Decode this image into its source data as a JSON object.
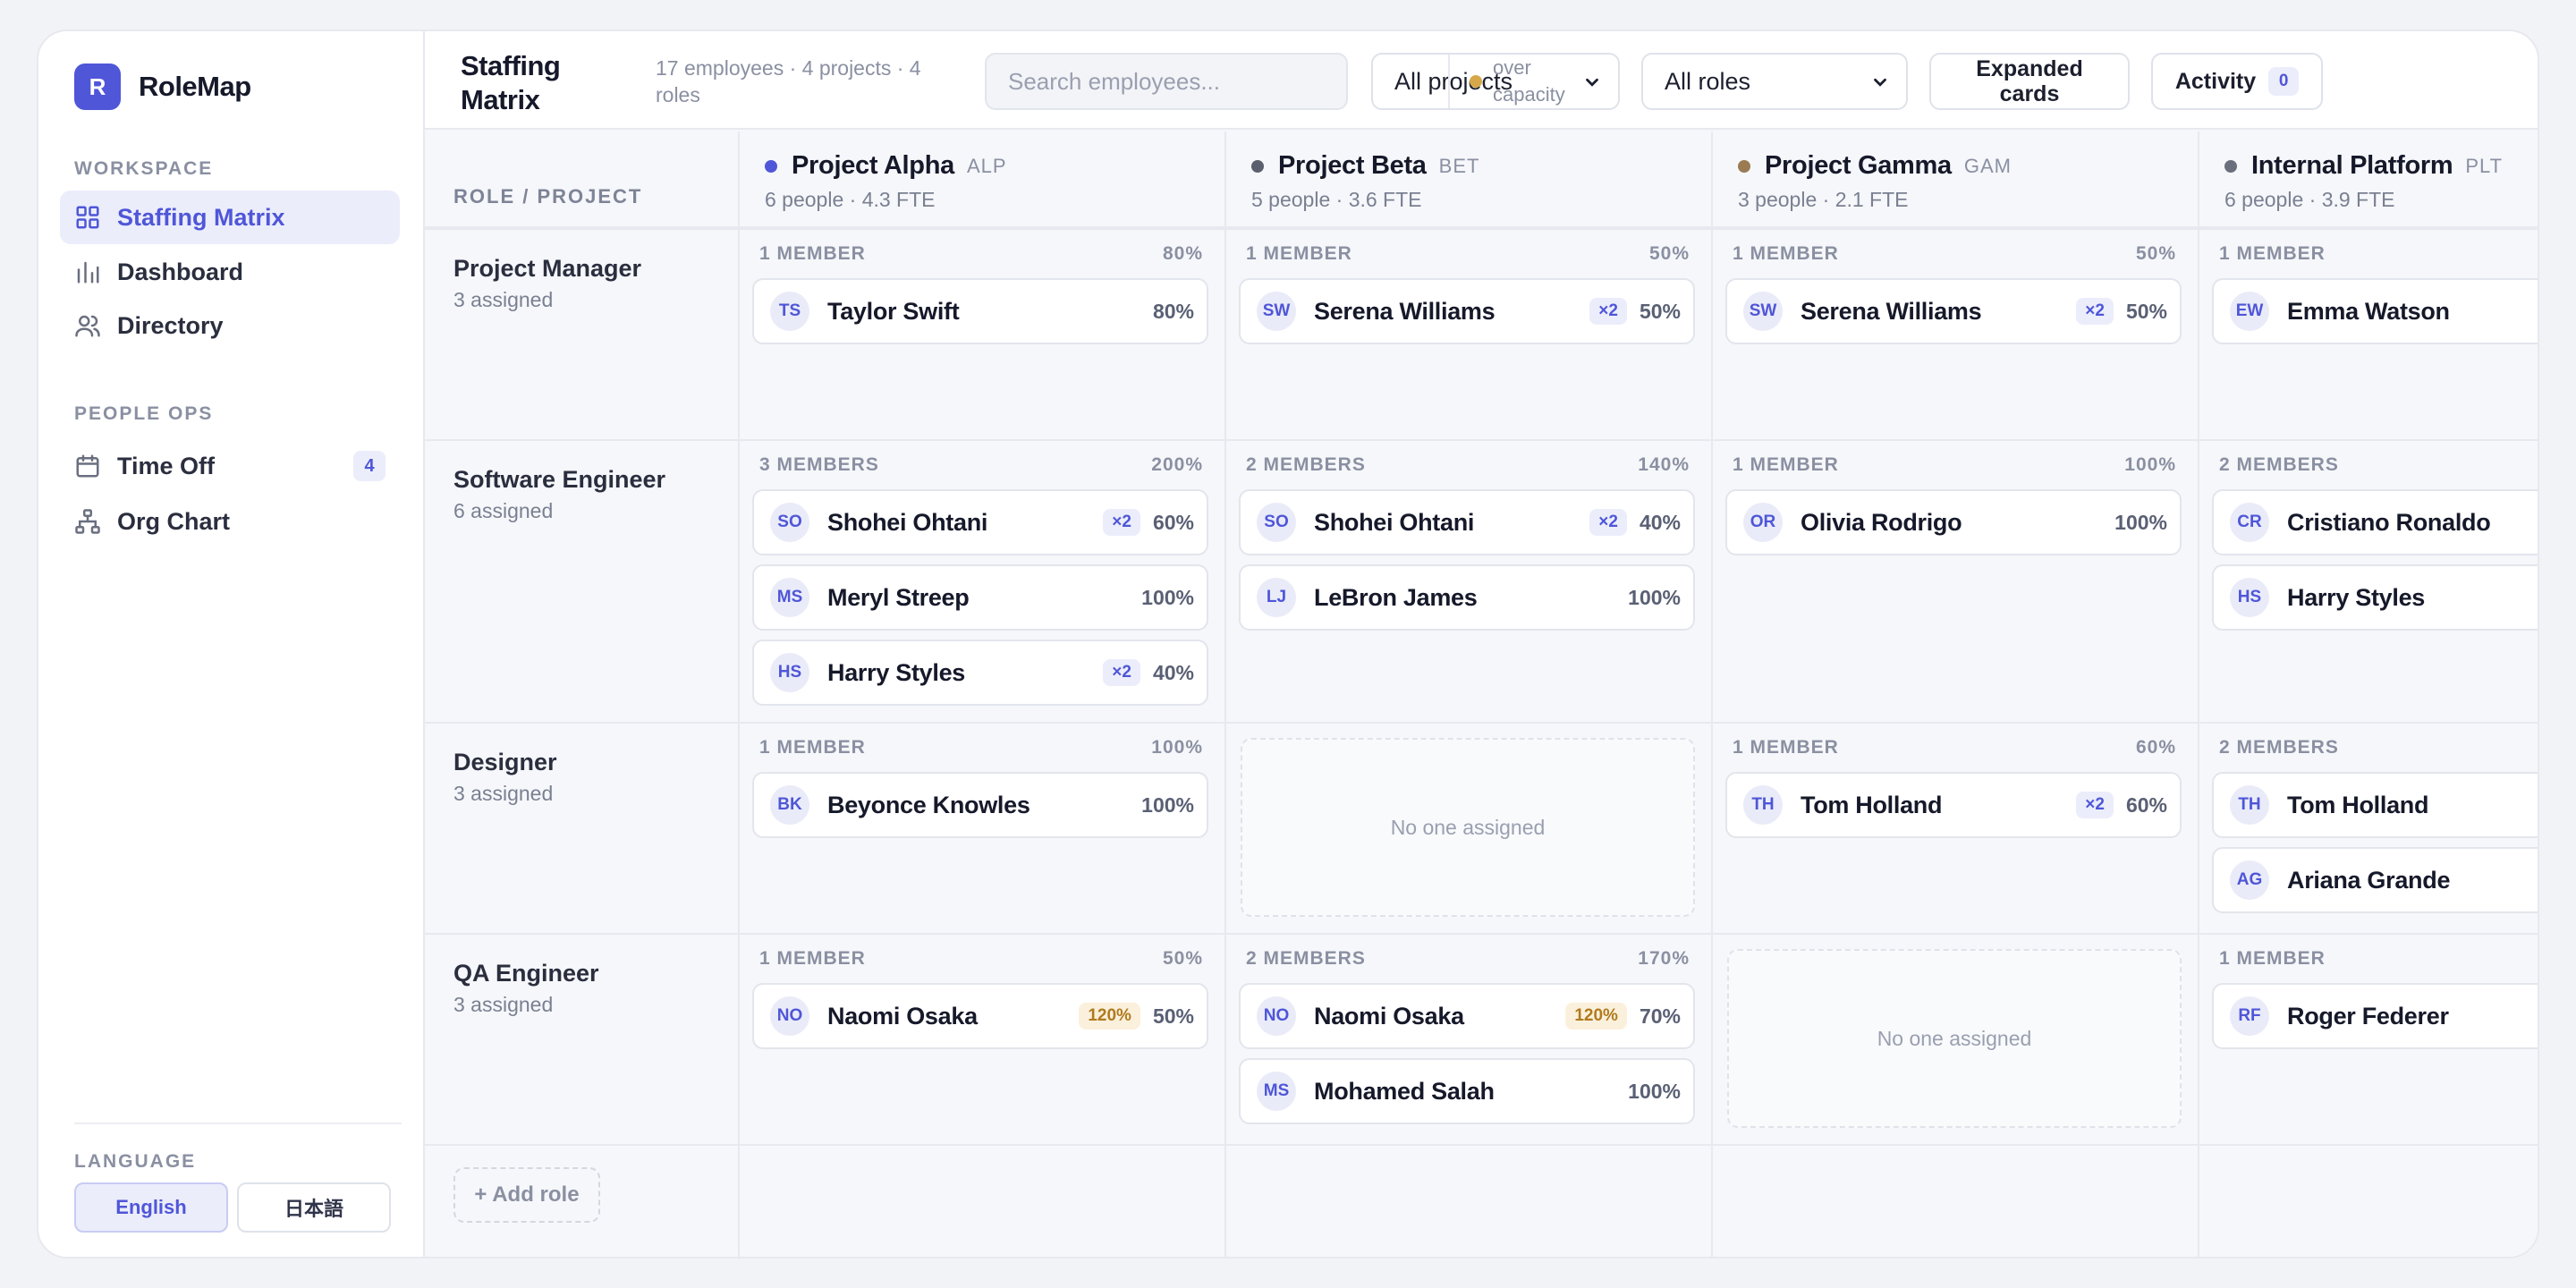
{
  "brand": {
    "logo_letter": "R",
    "name": "RoleMap"
  },
  "sidebar": {
    "workspace_label": "WORKSPACE",
    "workspace_items": [
      {
        "label": "Staffing Matrix",
        "icon": "grid-icon",
        "active": true
      },
      {
        "label": "Dashboard",
        "icon": "bar-chart-icon",
        "active": false
      },
      {
        "label": "Directory",
        "icon": "users-icon",
        "active": false
      }
    ],
    "peopleops_label": "PEOPLE OPS",
    "peopleops_items": [
      {
        "label": "Time Off",
        "icon": "calendar-icon",
        "badge": "4"
      },
      {
        "label": "Org Chart",
        "icon": "org-chart-icon",
        "badge": ""
      }
    ],
    "language_label": "LANGUAGE",
    "languages": [
      {
        "label": "English",
        "active": true
      },
      {
        "label": "日本語",
        "active": false
      }
    ]
  },
  "header": {
    "title": "Staffing Matrix",
    "subtitle": "17 employees · 4 projects · 4 roles",
    "search_placeholder": "Search employees...",
    "project_filter": "All projects",
    "role_filter": "All roles",
    "view_toggle": "Expanded cards",
    "activity_label": "Activity",
    "activity_count": "0",
    "legend_label": "over capacity",
    "legend_color": "#d6a84a"
  },
  "grid": {
    "corner_label": "ROLE / PROJECT",
    "projects": [
      {
        "name": "Project Alpha",
        "code": "ALP",
        "stats": "6 people · 4.3 FTE",
        "color": "#4f56d8"
      },
      {
        "name": "Project Beta",
        "code": "BET",
        "stats": "5 people · 3.6 FTE",
        "color": "#5b5f6e"
      },
      {
        "name": "Project Gamma",
        "code": "GAM",
        "stats": "3 people · 2.1 FTE",
        "color": "#9a7b52"
      },
      {
        "name": "Internal Platform",
        "code": "PLT",
        "stats": "6 people · 3.9 FTE",
        "color": "#6b6f7d"
      }
    ],
    "roles": [
      {
        "name": "Project Manager",
        "count": "3 assigned",
        "cells": [
          {
            "header": "1 MEMBER",
            "total": "80%",
            "members": [
              {
                "initials": "TS",
                "name": "Taylor Swift",
                "multi": "",
                "over": "",
                "pct": "80%"
              }
            ]
          },
          {
            "header": "1 MEMBER",
            "total": "50%",
            "members": [
              {
                "initials": "SW",
                "name": "Serena Williams",
                "multi": "×2",
                "over": "",
                "pct": "50%"
              }
            ]
          },
          {
            "header": "1 MEMBER",
            "total": "50%",
            "members": [
              {
                "initials": "SW",
                "name": "Serena Williams",
                "multi": "×2",
                "over": "",
                "pct": "50%"
              }
            ]
          },
          {
            "header": "1 MEMBER",
            "total": "",
            "members": [
              {
                "initials": "EW",
                "name": "Emma Watson",
                "multi": "",
                "over": "",
                "pct": ""
              }
            ]
          }
        ]
      },
      {
        "name": "Software Engineer",
        "count": "6 assigned",
        "cells": [
          {
            "header": "3 MEMBERS",
            "total": "200%",
            "members": [
              {
                "initials": "SO",
                "name": "Shohei Ohtani",
                "multi": "×2",
                "over": "",
                "pct": "60%"
              },
              {
                "initials": "MS",
                "name": "Meryl Streep",
                "multi": "",
                "over": "",
                "pct": "100%"
              },
              {
                "initials": "HS",
                "name": "Harry Styles",
                "multi": "×2",
                "over": "",
                "pct": "40%"
              }
            ]
          },
          {
            "header": "2 MEMBERS",
            "total": "140%",
            "members": [
              {
                "initials": "SO",
                "name": "Shohei Ohtani",
                "multi": "×2",
                "over": "",
                "pct": "40%"
              },
              {
                "initials": "LJ",
                "name": "LeBron James",
                "multi": "",
                "over": "",
                "pct": "100%"
              }
            ]
          },
          {
            "header": "1 MEMBER",
            "total": "100%",
            "members": [
              {
                "initials": "OR",
                "name": "Olivia Rodrigo",
                "multi": "",
                "over": "",
                "pct": "100%"
              }
            ]
          },
          {
            "header": "2 MEMBERS",
            "total": "",
            "members": [
              {
                "initials": "CR",
                "name": "Cristiano Ronaldo",
                "multi": "",
                "over": "",
                "pct": ""
              },
              {
                "initials": "HS",
                "name": "Harry Styles",
                "multi": "",
                "over": "",
                "pct": ""
              }
            ]
          }
        ]
      },
      {
        "name": "Designer",
        "count": "3 assigned",
        "cells": [
          {
            "header": "1 MEMBER",
            "total": "100%",
            "members": [
              {
                "initials": "BK",
                "name": "Beyonce Knowles",
                "multi": "",
                "over": "",
                "pct": "100%"
              }
            ]
          },
          {
            "header": "",
            "total": "",
            "empty": "No one assigned",
            "members": []
          },
          {
            "header": "1 MEMBER",
            "total": "60%",
            "members": [
              {
                "initials": "TH",
                "name": "Tom Holland",
                "multi": "×2",
                "over": "",
                "pct": "60%"
              }
            ]
          },
          {
            "header": "2 MEMBERS",
            "total": "",
            "members": [
              {
                "initials": "TH",
                "name": "Tom Holland",
                "multi": "",
                "over": "",
                "pct": ""
              },
              {
                "initials": "AG",
                "name": "Ariana Grande",
                "multi": "",
                "over": "",
                "pct": ""
              }
            ]
          }
        ]
      },
      {
        "name": "QA Engineer",
        "count": "3 assigned",
        "cells": [
          {
            "header": "1 MEMBER",
            "total": "50%",
            "members": [
              {
                "initials": "NO",
                "name": "Naomi Osaka",
                "multi": "",
                "over": "120%",
                "pct": "50%"
              }
            ]
          },
          {
            "header": "2 MEMBERS",
            "total": "170%",
            "members": [
              {
                "initials": "NO",
                "name": "Naomi Osaka",
                "multi": "",
                "over": "120%",
                "pct": "70%"
              },
              {
                "initials": "MS",
                "name": "Mohamed Salah",
                "multi": "",
                "over": "",
                "pct": "100%"
              }
            ]
          },
          {
            "header": "",
            "total": "",
            "empty": "No one assigned",
            "members": []
          },
          {
            "header": "1 MEMBER",
            "total": "",
            "members": [
              {
                "initials": "RF",
                "name": "Roger Federer",
                "multi": "",
                "over": "",
                "pct": ""
              }
            ]
          }
        ]
      }
    ],
    "add_role_label": "+ Add role"
  }
}
